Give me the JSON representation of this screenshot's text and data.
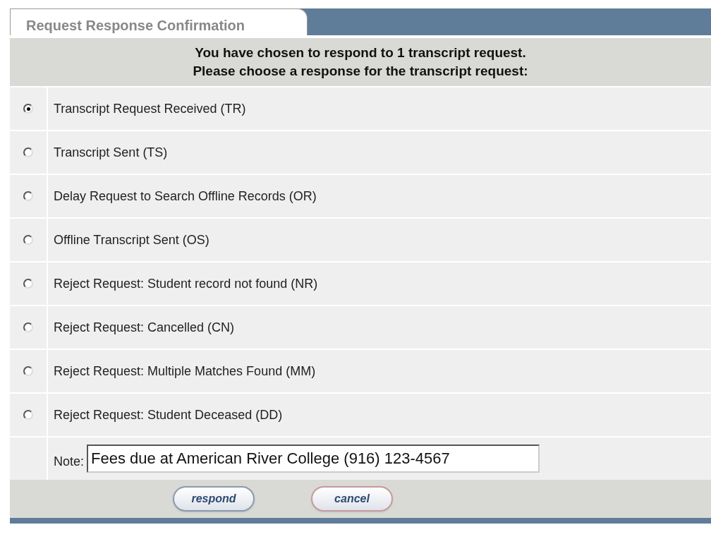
{
  "tab": {
    "label": "Request Response Confirmation",
    "selected": true
  },
  "intro": [
    "You have chosen to respond to **1** transcript request.",
    "Please choose a response for the transcript request:"
  ],
  "options": [
    {
      "label": "Transcript Request Received (TR)",
      "selected": true
    },
    {
      "label": "Transcript Sent (TS)",
      "selected": false
    },
    {
      "label": "Delay Request to Search Offline Records (OR)",
      "selected": false
    },
    {
      "label": "Offline Transcript Sent (OS)",
      "selected": false
    },
    {
      "label": "Reject Request: Student record not found (NR)",
      "selected": false
    },
    {
      "label": "Reject Request: Cancelled (CN)",
      "selected": false
    },
    {
      "label": "Reject Request: Multiple Matches Found (MM)",
      "selected": false
    },
    {
      "label": "Reject Request: Student Deceased (DD)",
      "selected": false
    }
  ],
  "note": {
    "label": "Note:",
    "value": "Fees due at American River College (916) 123-4567"
  },
  "buttons": [
    {
      "label": "respond",
      "kind": "primary"
    },
    {
      "label": "cancel",
      "kind": "secondary"
    }
  ]
}
